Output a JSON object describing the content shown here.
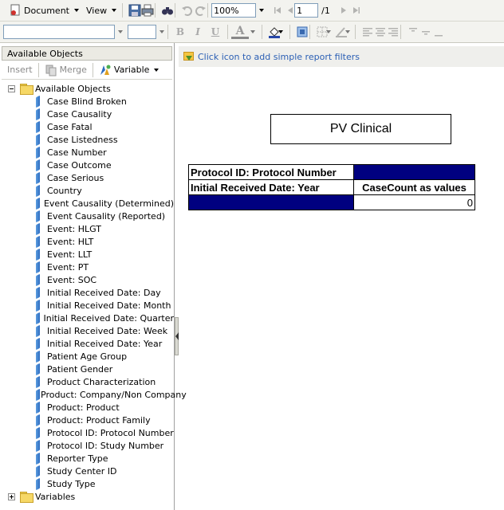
{
  "toolbar": {
    "document_label": "Document",
    "view_label": "View",
    "zoom_value": "100%",
    "page_value": "1",
    "page_total": "/1"
  },
  "format_toolbar": {
    "bold": "B",
    "italic": "I",
    "underline": "U",
    "font_color": "A"
  },
  "left_panel": {
    "header": "Available Objects",
    "insert_label": "Insert",
    "merge_label": "Merge",
    "variable_label": "Variable",
    "root_label": "Available Objects",
    "objects": [
      "Case Blind Broken",
      "Case Causality",
      "Case Fatal",
      "Case Listedness",
      "Case Number",
      "Case Outcome",
      "Case Serious",
      "Country",
      "Event Causality (Determined)",
      "Event Causality (Reported)",
      "Event: HLGT",
      "Event: HLT",
      "Event: LLT",
      "Event: PT",
      "Event: SOC",
      "Initial Received Date: Day",
      "Initial Received Date: Month",
      "Initial Received Date: Quarter",
      "Initial Received Date: Week",
      "Initial Received Date: Year",
      "Patient Age Group",
      "Patient Gender",
      "Product Characterization",
      "Product: Company/Non Company",
      "Product: Product",
      "Product: Product Family",
      "Protocol ID: Protocol Number",
      "Protocol ID: Study Number",
      "Reporter Type",
      "Study Center ID",
      "Study Type"
    ],
    "variables_label": "Variables"
  },
  "report": {
    "filter_hint": "Click icon to add simple report filters",
    "title": "PV Clinical",
    "crosstab": {
      "row1_header": "Protocol  ID: Protocol Number",
      "row2_header": "Initial Received Date: Year",
      "measure_header": "CaseCount as values",
      "value": "0"
    }
  },
  "colors": {
    "header_fill": "#000080",
    "link_text": "#2b5fb4"
  }
}
